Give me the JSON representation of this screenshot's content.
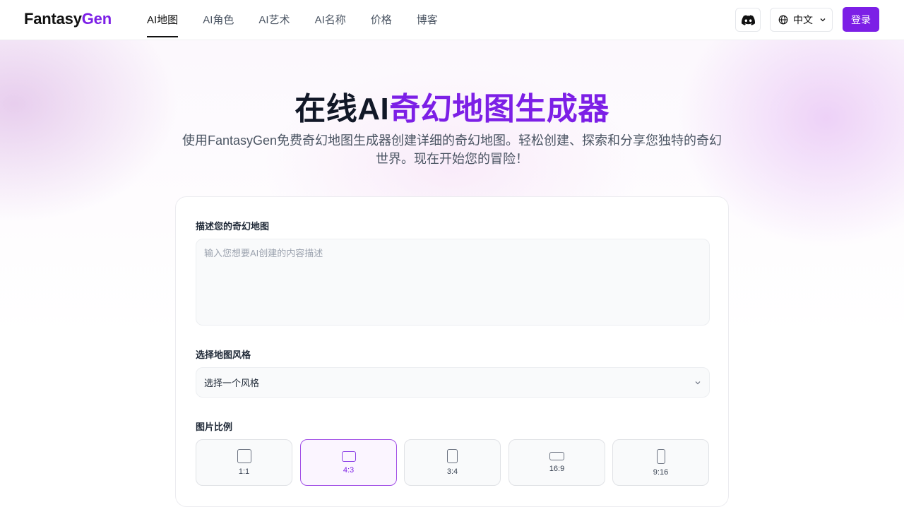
{
  "header": {
    "logo_part1": "Fantasy",
    "logo_part2": "Gen",
    "nav": [
      {
        "label": "AI地图",
        "active": true
      },
      {
        "label": "AI角色"
      },
      {
        "label": "AI艺术"
      },
      {
        "label": "AI名称"
      },
      {
        "label": "价格"
      },
      {
        "label": "博客"
      }
    ],
    "language": "中文",
    "login_label": "登录"
  },
  "hero": {
    "title_plain": "在线AI",
    "title_accent": "奇幻地图生成器",
    "subtitle": "使用FantasyGen免费奇幻地图生成器创建详细的奇幻地图。轻松创建、探索和分享您独特的奇幻世界。现在开始您的冒险！"
  },
  "form": {
    "describe_label": "描述您的奇幻地图",
    "describe_placeholder": "输入您想要AI创建的内容描述",
    "style_label": "选择地图风格",
    "style_value": "选择一个风格",
    "ratio_label": "图片比例",
    "ratios": [
      {
        "label": "1:1",
        "selected": false
      },
      {
        "label": "4:3",
        "selected": true
      },
      {
        "label": "3:4",
        "selected": false
      },
      {
        "label": "16:9",
        "selected": false
      },
      {
        "label": "9:16",
        "selected": false
      }
    ]
  },
  "colors": {
    "brand": "#7c1fe6",
    "text": "#111827"
  },
  "icons": [
    "discord-icon",
    "globe-icon",
    "chevron-down-icon"
  ]
}
